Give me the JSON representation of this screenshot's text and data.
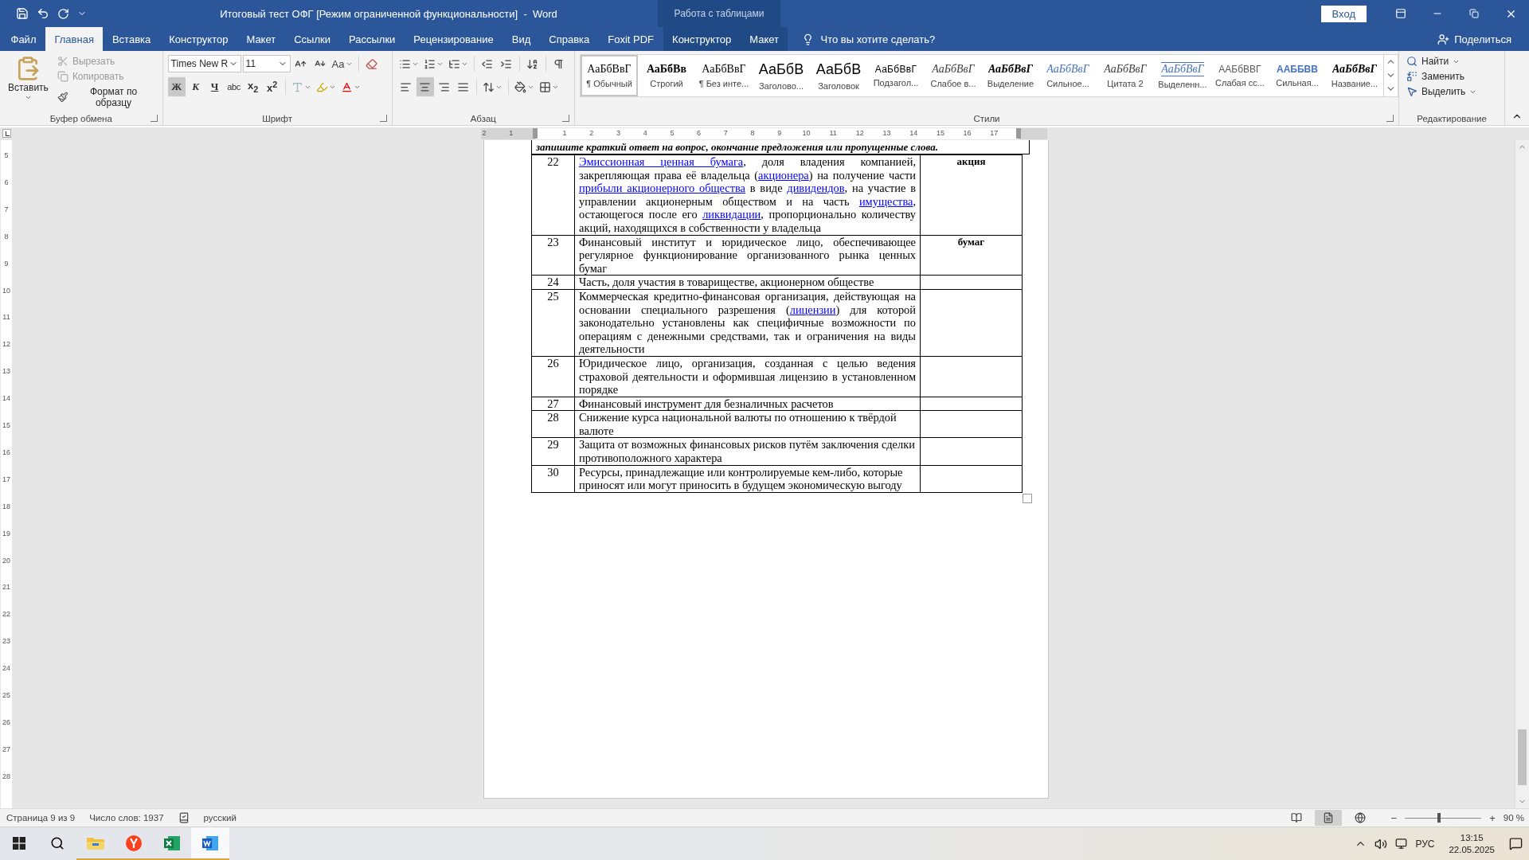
{
  "window": {
    "title": "Итоговый тест ОФГ [Режим ограниченной функциональности]  -  Word",
    "context_title": "Работа с таблицами",
    "signin": "Вход"
  },
  "tabs": [
    {
      "label": "Файл",
      "selected": false,
      "contextual": false
    },
    {
      "label": "Главная",
      "selected": true,
      "contextual": false
    },
    {
      "label": "Вставка",
      "selected": false,
      "contextual": false
    },
    {
      "label": "Конструктор",
      "selected": false,
      "contextual": false
    },
    {
      "label": "Макет",
      "selected": false,
      "contextual": false
    },
    {
      "label": "Ссылки",
      "selected": false,
      "contextual": false
    },
    {
      "label": "Рассылки",
      "selected": false,
      "contextual": false
    },
    {
      "label": "Рецензирование",
      "selected": false,
      "contextual": false
    },
    {
      "label": "Вид",
      "selected": false,
      "contextual": false
    },
    {
      "label": "Справка",
      "selected": false,
      "contextual": false
    },
    {
      "label": "Foxit PDF",
      "selected": false,
      "contextual": false
    },
    {
      "label": "Конструктор",
      "selected": false,
      "contextual": true
    },
    {
      "label": "Макет",
      "selected": false,
      "contextual": true
    }
  ],
  "tell_me": "Что вы хотите сделать?",
  "share": "Поделиться",
  "clipboard": {
    "label": "Буфер обмена",
    "paste": "Вставить",
    "items": [
      {
        "label": "Вырезать",
        "kind": "cut",
        "disabled": true
      },
      {
        "label": "Копировать",
        "kind": "copy",
        "disabled": true
      },
      {
        "label": "Формат по образцу",
        "kind": "painter",
        "disabled": false
      }
    ]
  },
  "font": {
    "label": "Шрифт",
    "name": "Times New R",
    "size": "11",
    "case_button": "Aa",
    "format_buttons": [
      {
        "label": "Ж",
        "kind": "bold",
        "selected": true
      },
      {
        "label": "К",
        "kind": "italic",
        "selected": false
      },
      {
        "label": "Ч",
        "kind": "underline",
        "selected": false
      },
      {
        "label": "abc",
        "kind": "strike",
        "selected": false
      },
      {
        "label": "x$_{2}$",
        "kind": "subscript",
        "selected": false
      },
      {
        "label": "x$^{2}$",
        "kind": "superscript",
        "selected": false
      }
    ]
  },
  "paragraph": {
    "label": "Абзац",
    "alignments": [
      {
        "kind": "left",
        "selected": false
      },
      {
        "kind": "center",
        "selected": true
      },
      {
        "kind": "right",
        "selected": false
      },
      {
        "kind": "justify",
        "selected": false
      }
    ]
  },
  "styles": {
    "label": "Стили",
    "items": [
      {
        "preview": "АаБбВвГ",
        "label": "¶ Обычный",
        "kind": "normal",
        "selected": true
      },
      {
        "preview": "АаБбВв",
        "label": "Строгий",
        "kind": "strict",
        "selected": false
      },
      {
        "preview": "АаБбВвГ",
        "label": "¶ Без инте...",
        "kind": "nospacing",
        "selected": false
      },
      {
        "preview": "АаБбВ",
        "label": "Заголово...",
        "kind": "heading1",
        "selected": false
      },
      {
        "preview": "АаБбВ",
        "label": "Заголовок",
        "kind": "heading",
        "selected": false
      },
      {
        "preview": "АаБбВвГ",
        "label": "Подзагол...",
        "kind": "subtitle",
        "selected": false
      },
      {
        "preview": "АаБбВвГ",
        "label": "Слабое в...",
        "kind": "subtle",
        "selected": false
      },
      {
        "preview": "АаБбВвГ",
        "label": "Выделение",
        "kind": "emphasis",
        "selected": false
      },
      {
        "preview": "АаБбВвГ",
        "label": "Сильное...",
        "kind": "intense",
        "selected": false
      },
      {
        "preview": "АаБбВвГ",
        "label": "Цитата 2",
        "kind": "quote",
        "selected": false
      },
      {
        "preview": "АаБбВвГ",
        "label": "Выделенн...",
        "kind": "intensequote",
        "selected": false
      },
      {
        "preview": "ААБбВВГ",
        "label": "Слабая сс...",
        "kind": "subtleref",
        "selected": false
      },
      {
        "preview": "ААББВВ",
        "label": "Сильная...",
        "kind": "intenseref",
        "selected": false
      },
      {
        "preview": "АаБбВвГ",
        "label": "Название...",
        "kind": "booktitle",
        "selected": false
      }
    ]
  },
  "editing": {
    "label": "Редактирование",
    "items": [
      {
        "label": "Найти",
        "kind": "find"
      },
      {
        "label": "Заменить",
        "kind": "replace"
      },
      {
        "label": "Выделить",
        "kind": "select"
      }
    ]
  },
  "ruler": {
    "numbers": [
      "2",
      "1",
      "1",
      "2",
      "3",
      "4",
      "5",
      "6",
      "7",
      "8",
      "9",
      "10",
      "11",
      "12",
      "13",
      "14",
      "15",
      "16",
      "17"
    ],
    "vertical_numbers": [
      "5",
      "6",
      "7",
      "8",
      "9",
      "10",
      "11",
      "12",
      "13",
      "14",
      "15",
      "16",
      "17",
      "18",
      "19",
      "20",
      "21",
      "22",
      "23",
      "24",
      "25",
      "26",
      "27",
      "28"
    ]
  },
  "document": {
    "instruction": "запишите краткий ответ на вопрос, окончание предложения или пропущенные слова.",
    "rows": [
      {
        "number": "22",
        "justified": true,
        "answer": "акция",
        "segments": [
          {
            "text": "Эмиссионная ценная бумага",
            "kind": "link"
          },
          {
            "text": ", доля владения компанией, закрепляющая права её владельца (",
            "kind": "text"
          },
          {
            "text": "акционера",
            "kind": "link"
          },
          {
            "text": ") на получение части ",
            "kind": "text"
          },
          {
            "text": "прибыли акционерного общества",
            "kind": "link"
          },
          {
            "text": " в виде ",
            "kind": "text"
          },
          {
            "text": "дивидендов",
            "kind": "link"
          },
          {
            "text": ", на участие в управлении акционерным обществом и на часть ",
            "kind": "text"
          },
          {
            "text": "имущества",
            "kind": "link"
          },
          {
            "text": ", остающегося после его ",
            "kind": "text"
          },
          {
            "text": "ликвидации",
            "kind": "link"
          },
          {
            "text": ", пропорционально количеству акций, находящихся в собственности у владельца",
            "kind": "text"
          }
        ]
      },
      {
        "number": "23",
        "justified": true,
        "answer": "бумаг",
        "segments": [
          {
            "text": "Финансовый институт и юридическое лицо, обеспечивающее регулярное функционирование организованного рынка ценных бумаг",
            "kind": "text"
          }
        ]
      },
      {
        "number": "24",
        "segments": [
          {
            "text": "Часть, доля участия в товариществе, акционерном обществе",
            "kind": "text"
          }
        ]
      },
      {
        "number": "25",
        "justified": true,
        "segments": [
          {
            "text": "Коммерческая кредитно-финансовая организация, действующая на основании специального разрешения (",
            "kind": "text"
          },
          {
            "text": "лицензии",
            "kind": "link"
          },
          {
            "text": ") для которой законодательно установлены как специфичные возможности по операциям с денежными средствами, так и ограничения на виды деятельности",
            "kind": "text"
          }
        ]
      },
      {
        "number": "26",
        "justified": true,
        "segments": [
          {
            "text": "Юридическое лицо, организация, созданная с целью ведения страховой деятельности и оформившая лицензию в установленном порядке",
            "kind": "text"
          }
        ]
      },
      {
        "number": "27",
        "segments": [
          {
            "text": "Финансовый инструмент для безналичных расчетов",
            "kind": "text"
          }
        ]
      },
      {
        "number": "28",
        "justified": false,
        "segments": [
          {
            "text": "Снижение курса национальной валюты по отношению к твёрдой валюте",
            "kind": "text"
          }
        ]
      },
      {
        "number": "29",
        "justified": false,
        "segments": [
          {
            "text": "Защита от возможных финансовых рисков путём заключения сделки противоположного характера",
            "kind": "text"
          }
        ]
      },
      {
        "number": "30",
        "justified": false,
        "segments": [
          {
            "text": "Ресурсы, принадлежащие или контролируемые кем-либо, которые приносят или могут приносить в будущем экономическую выгоду",
            "kind": "text"
          }
        ]
      }
    ]
  },
  "status_bar": {
    "page": "Страница 9 из 9",
    "words": "Число слов: 1937",
    "language": "русский",
    "views": [
      {
        "kind": "read",
        "selected": false
      },
      {
        "kind": "print",
        "selected": true
      },
      {
        "kind": "web",
        "selected": false
      }
    ],
    "zoom_out": "−",
    "zoom_in": "+",
    "zoom": {
      "level": 0.45
    },
    "zoom_reading": "90 %"
  },
  "taskbar": {
    "apps": [
      {
        "kind": "explorer",
        "selected": false
      },
      {
        "kind": "browser",
        "selected": false
      },
      {
        "kind": "excel",
        "selected": false
      },
      {
        "kind": "word",
        "selected": true
      }
    ],
    "language": "РУС",
    "time": "13:15",
    "date": "22.05.2025"
  }
}
